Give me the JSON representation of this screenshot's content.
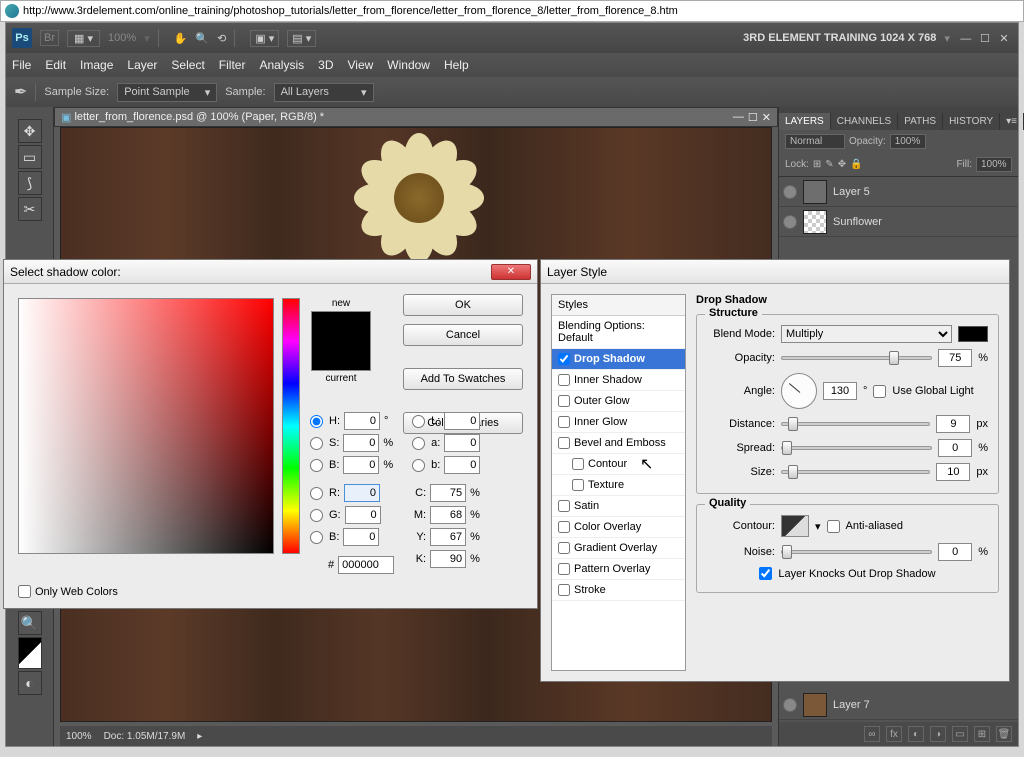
{
  "browser": {
    "url": "http://www.3rdelement.com/online_training/photoshop_tutorials/letter_from_florence/letter_from_florence_8/letter_from_florence_8.htm"
  },
  "ps": {
    "title": "3RD ELEMENT TRAINING 1024 X 768",
    "zoom_dd": "100%",
    "menu": [
      "File",
      "Edit",
      "Image",
      "Layer",
      "Select",
      "Filter",
      "Analysis",
      "3D",
      "View",
      "Window",
      "Help"
    ],
    "opts": {
      "sample_size_l": "Sample Size:",
      "sample_size": "Point Sample",
      "sample_l": "Sample:",
      "sample": "All Layers"
    },
    "doc": {
      "tab": "letter_from_florence.psd @ 100% (Paper, RGB/8) *",
      "zoom": "100%",
      "info": "Doc:  1.05M/17.9M"
    },
    "panels": {
      "tabs": [
        "LAYERS",
        "CHANNELS",
        "PATHS",
        "HISTORY"
      ],
      "blend": "Normal",
      "opacity_l": "Opacity:",
      "opacity": "100%",
      "fill_l": "Fill:",
      "fill": "100%",
      "lock_l": "Lock:",
      "layers": [
        {
          "n": "Layer 5"
        },
        {
          "n": "Sunflower"
        },
        {
          "n": "Layer 7"
        }
      ]
    }
  },
  "cp": {
    "title": "Select shadow color:",
    "new": "new",
    "current": "current",
    "btns": {
      "ok": "OK",
      "cancel": "Cancel",
      "add": "Add To Swatches",
      "lib": "Color Libraries"
    },
    "owc": "Only Web Colors",
    "vals": {
      "H": "0",
      "S": "0",
      "B": "0",
      "R": "0",
      "G": "0",
      "B2": "0",
      "L": "0",
      "a": "0",
      "b": "0",
      "C": "75",
      "M": "68",
      "Y": "67",
      "K": "90",
      "hex": "000000"
    },
    "labs": {
      "H": "H:",
      "S": "S:",
      "B": "B:",
      "R": "R:",
      "G": "G:",
      "B2": "B:",
      "L": "L:",
      "a": "a:",
      "b": "b:",
      "C": "C:",
      "M": "M:",
      "Y": "Y:",
      "K": "K:",
      "hash": "#",
      "deg": "°",
      "pct": "%"
    }
  },
  "ls": {
    "title": "Layer Style",
    "styles_hdr": "Styles",
    "items": [
      {
        "l": "Blending Options: Default",
        "cb": false,
        "hdr": true
      },
      {
        "l": "Drop Shadow",
        "cb": true,
        "chk": true,
        "sel": true
      },
      {
        "l": "Inner Shadow",
        "cb": true
      },
      {
        "l": "Outer Glow",
        "cb": true
      },
      {
        "l": "Inner Glow",
        "cb": true
      },
      {
        "l": "Bevel and Emboss",
        "cb": true
      },
      {
        "l": "Contour",
        "cb": true,
        "sub": true
      },
      {
        "l": "Texture",
        "cb": true,
        "sub": true
      },
      {
        "l": "Satin",
        "cb": true
      },
      {
        "l": "Color Overlay",
        "cb": true
      },
      {
        "l": "Gradient Overlay",
        "cb": true
      },
      {
        "l": "Pattern Overlay",
        "cb": true
      },
      {
        "l": "Stroke",
        "cb": true
      }
    ],
    "ds": {
      "hdr": "Drop Shadow",
      "structure": "Structure",
      "quality": "Quality",
      "blend_l": "Blend Mode:",
      "blend": "Multiply",
      "opacity_l": "Opacity:",
      "opacity": "75",
      "pct": "%",
      "angle_l": "Angle:",
      "angle": "130",
      "deg": "°",
      "ugl": "Use Global Light",
      "distance_l": "Distance:",
      "distance": "9",
      "px": "px",
      "spread_l": "Spread:",
      "spread": "0",
      "size_l": "Size:",
      "size": "10",
      "contour_l": "Contour:",
      "aa": "Anti-aliased",
      "noise_l": "Noise:",
      "noise": "0",
      "knock": "Layer Knocks Out Drop Shadow"
    }
  }
}
